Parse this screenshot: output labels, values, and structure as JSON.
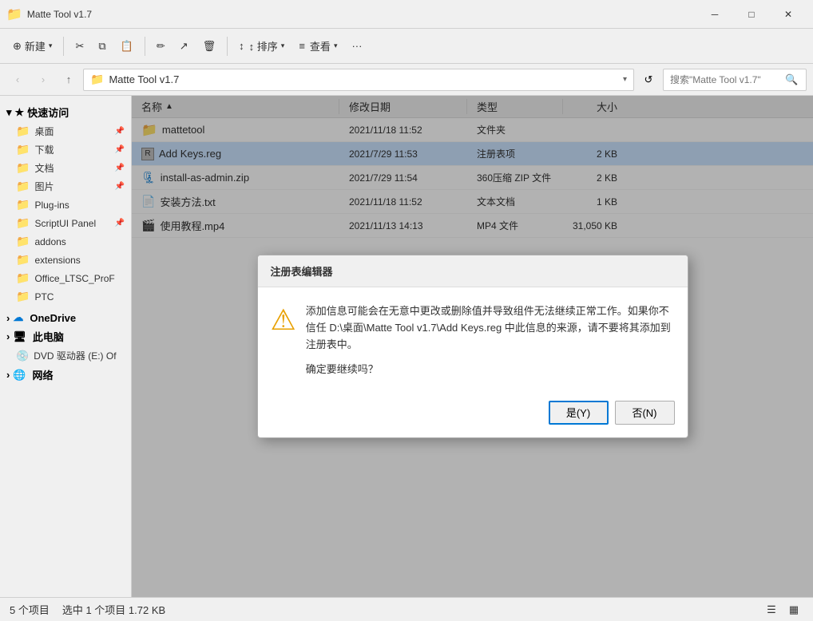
{
  "titlebar": {
    "title": "Matte Tool v1.7",
    "icon": "📁",
    "min_label": "─",
    "max_label": "□",
    "close_label": "✕"
  },
  "toolbar": {
    "new_btn": "新建",
    "cut_icon": "✂",
    "copy_icon": "⎘",
    "paste_icon": "📋",
    "rename_icon": "✏",
    "delete_icon": "🗑",
    "move_icon": "➡",
    "sort_btn": "↕ 排序",
    "view_btn": "≡ 查看",
    "more_btn": "···"
  },
  "addressbar": {
    "back_disabled": true,
    "forward_disabled": true,
    "up_label": "↑",
    "folder_icon": "📁",
    "path": "Matte Tool v1.7",
    "search_placeholder": "搜索\"Matte Tool v1.7\""
  },
  "sidebar": {
    "quickaccess_label": "快速访问",
    "items": [
      {
        "id": "desktop",
        "label": "桌面",
        "has_pin": true
      },
      {
        "id": "downloads",
        "label": "下载",
        "has_pin": true
      },
      {
        "id": "documents",
        "label": "文档",
        "has_pin": true
      },
      {
        "id": "pictures",
        "label": "图片",
        "has_pin": true
      },
      {
        "id": "plugins",
        "label": "Plug-ins"
      },
      {
        "id": "scriptui",
        "label": "ScriptUI Panel",
        "has_pin": true
      },
      {
        "id": "addons",
        "label": "addons"
      },
      {
        "id": "extensions",
        "label": "extensions"
      },
      {
        "id": "office",
        "label": "Office_LTSC_ProF"
      },
      {
        "id": "ptc",
        "label": "PTC"
      }
    ],
    "onedrive_label": "OneDrive",
    "thispc_label": "此电脑",
    "dvd_label": "DVD 驱动器 (E:) Of",
    "network_label": "网络"
  },
  "filelist": {
    "columns": {
      "name": "名称",
      "date": "修改日期",
      "type": "类型",
      "size": "大小"
    },
    "files": [
      {
        "id": "mattetool",
        "name": "mattetool",
        "date": "2021/11/18 11:52",
        "type": "文件夹",
        "size": "",
        "icon": "folder",
        "selected": false
      },
      {
        "id": "addkeys",
        "name": "Add Keys.reg",
        "date": "2021/7/29 11:53",
        "type": "注册表项",
        "size": "2 KB",
        "icon": "reg",
        "selected": true
      },
      {
        "id": "install",
        "name": "install-as-admin.zip",
        "date": "2021/7/29 11:54",
        "type": "360压缩 ZIP 文件",
        "size": "2 KB",
        "icon": "zip",
        "selected": false
      },
      {
        "id": "readme",
        "name": "安装方法.txt",
        "date": "2021/11/18 11:52",
        "type": "文本文档",
        "size": "1 KB",
        "icon": "txt",
        "selected": false
      },
      {
        "id": "tutorial",
        "name": "使用教程.mp4",
        "date": "2021/11/13 14:13",
        "type": "MP4 文件",
        "size": "31,050 KB",
        "icon": "mp4",
        "selected": false
      }
    ]
  },
  "statusbar": {
    "count": "5 个项目",
    "selected": "选中 1 个项目  1.72 KB"
  },
  "dialog": {
    "title": "注册表编辑器",
    "warning_icon": "⚠",
    "message": "添加信息可能会在无意中更改或删除值并导致组件无法继续正常工作。如果你不信任 D:\\桌面\\Matte Tool v1.7\\Add Keys.reg 中此信息的来源，请不要将其添加到注册表中。",
    "confirm_text": "确定要继续吗？",
    "yes_btn": "是(Y)",
    "no_btn": "否(N)"
  }
}
